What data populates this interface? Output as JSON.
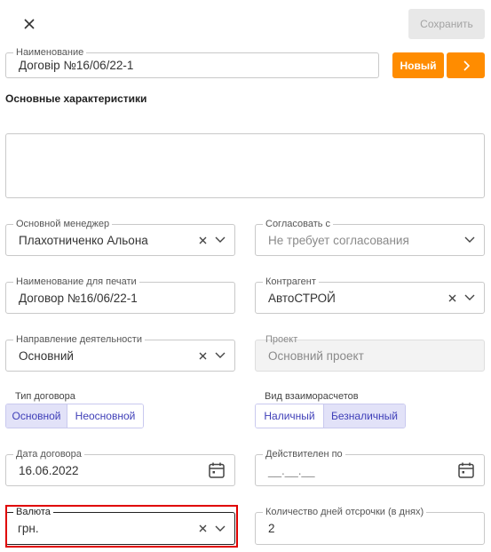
{
  "toolbar": {
    "save_label": "Сохранить"
  },
  "name_field": {
    "label": "Наименование",
    "value": "Договір №16/06/22-1"
  },
  "new_button": {
    "label": "Новый"
  },
  "section_title": "Основные характеристики",
  "description": {
    "value": ""
  },
  "manager": {
    "label": "Основной менеджер",
    "value": "Плахотниченко Альона"
  },
  "approve": {
    "label": "Согласовать с",
    "value": "Не требует согласования"
  },
  "print_name": {
    "label": "Наименование для печати",
    "value": "Договор №16/06/22-1"
  },
  "counterparty": {
    "label": "Контрагент",
    "value": "АвтоСТРОЙ"
  },
  "direction": {
    "label": "Направление деятельности",
    "value": "Основний"
  },
  "project": {
    "label": "Проект",
    "value": "Основний проект"
  },
  "contract_type": {
    "label": "Тип договора",
    "options": [
      "Основной",
      "Неосновной"
    ],
    "selected": "Основной"
  },
  "settlement_type": {
    "label": "Вид взаиморасчетов",
    "options": [
      "Наличный",
      "Безналичный"
    ],
    "selected": "Безналичный"
  },
  "contract_date": {
    "label": "Дата договора",
    "value": "16.06.2022"
  },
  "valid_until": {
    "label": "Действителен по",
    "value": "__.__.__"
  },
  "currency": {
    "label": "Валюта",
    "value": "грн."
  },
  "delay_days": {
    "label": "Количество дней отсрочки (в днях)",
    "value": "2"
  },
  "colors": {
    "accent": "#ff8c00",
    "segment_text": "#3f3fb8",
    "segment_active": "#e2e2f8",
    "highlight": "#e00000"
  },
  "icons": [
    "close-icon",
    "chevron-right-icon",
    "clear-icon",
    "chevron-down-icon",
    "calendar-icon"
  ]
}
